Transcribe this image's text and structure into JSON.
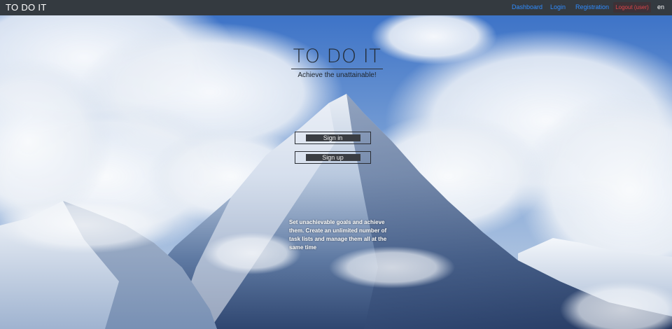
{
  "navbar": {
    "brand": "TO DO IT",
    "links": {
      "dashboard": "Dashboard",
      "login": "Login",
      "registration": "Registration",
      "logout": "Logout (user)",
      "language": "en"
    }
  },
  "hero": {
    "title": "TO DO IT",
    "subtitle": "Achieve the unattainable!",
    "sign_in": "Sign in",
    "sign_up": "Sign up",
    "description": "Set unachievable goals and achieve them. Create an unlimited number of task lists and manage them all at the same time"
  },
  "colors": {
    "navbar_bg": "#343a40",
    "link": "#2f8cff",
    "logout": "#e0454a",
    "sky": "#3f74c6",
    "button_bg": "#3a3d42"
  }
}
